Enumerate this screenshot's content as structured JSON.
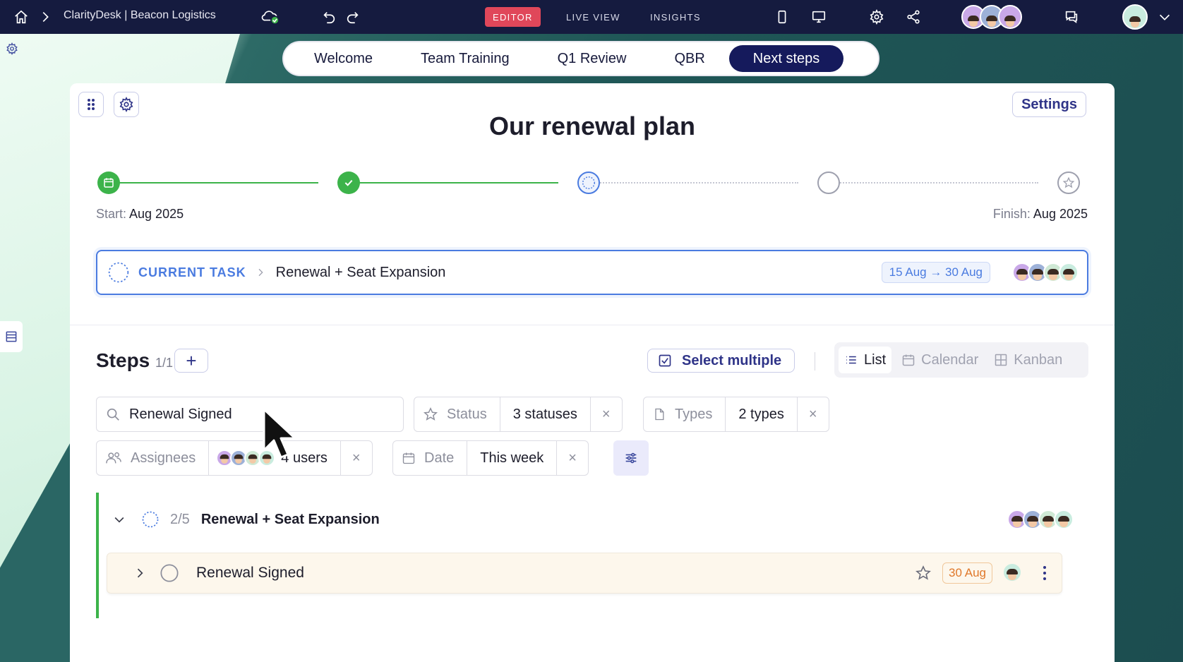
{
  "topbar": {
    "breadcrumb": "ClarityDesk | Beacon Logistics",
    "modes": [
      "EDITOR",
      "LIVE VIEW",
      "INSIGHTS"
    ],
    "active_mode": "EDITOR"
  },
  "page_tabs": [
    {
      "label": "Welcome",
      "active": false
    },
    {
      "label": "Team Training",
      "active": false
    },
    {
      "label": "Q1 Review",
      "active": false
    },
    {
      "label": "QBR",
      "active": false
    },
    {
      "label": "Next steps",
      "active": true
    }
  ],
  "card": {
    "settings_label": "Settings",
    "title": "Our renewal plan",
    "start_key": "Start:",
    "start_value": "Aug 2025",
    "finish_key": "Finish:",
    "finish_value": "Aug 2025"
  },
  "current_task": {
    "label": "CURRENT TASK",
    "name": "Renewal + Seat Expansion",
    "date_range": "15 Aug → 30 Aug"
  },
  "steps": {
    "title": "Steps",
    "count": "1/1",
    "add_label": "+",
    "select_multiple": "Select multiple",
    "views": [
      {
        "label": "List",
        "active": true
      },
      {
        "label": "Calendar",
        "active": false
      },
      {
        "label": "Kanban",
        "active": false
      }
    ]
  },
  "filters": {
    "search_value": "Renewal Signed",
    "status_key": "Status",
    "status_value": "3 statuses",
    "types_key": "Types",
    "types_value": "2 types",
    "assignees_key": "Assignees",
    "assignees_value": "4 users",
    "date_key": "Date",
    "date_value": "This week",
    "clear": "×"
  },
  "group": {
    "progress": "2/5",
    "name": "Renewal + Seat Expansion",
    "task": {
      "name": "Renewal Signed",
      "date": "30 Aug"
    }
  },
  "colors": {
    "topbar": "#151b3f",
    "editor_badge": "#e0475a",
    "active_tab": "#151a5c",
    "accent_blue": "#4a7be0",
    "complete_green": "#3cb34a",
    "due_orange": "#e0782a"
  }
}
